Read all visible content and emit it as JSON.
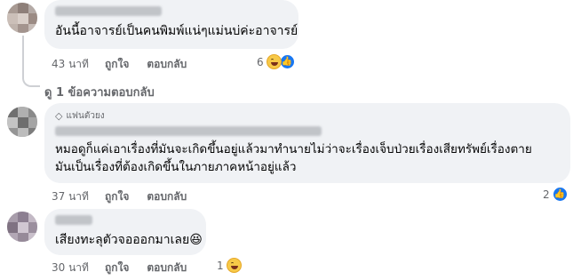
{
  "comments": [
    {
      "text_lines": [
        "อันนี้อาจารย์เป็นคนพิมพ์แน่ๆแม่นบ่ค่ะอาจารย์"
      ],
      "time": "43 นาที",
      "like_label": "ถูกใจ",
      "reply_label": "ตอบกลับ",
      "reaction_count": "6",
      "reactions": [
        "haha-icon",
        "like-icon"
      ]
    },
    {
      "badge": "แฟนตัวยง",
      "text_lines": [
        "หมอดูก็แค่เอาเรื่องที่มันจะเกิดขึ้นอยู่แล้วมาทำนายไม่ว่าจะเรื่องเจ็บป่วยเรื่องเสียทรัพย์เรื่องตาย",
        "มันเป็นเรื่องที่ต้องเกิดขึ้นในภายภาคหน้าอยู่แล้ว"
      ],
      "time": "37 นาที",
      "like_label": "ถูกใจ",
      "reply_label": "ตอบกลับ",
      "reaction_count": "2",
      "reactions": [
        "like-icon"
      ]
    },
    {
      "text_lines": [
        "เสียงทะลุตัวจอออกมาเลย😆"
      ],
      "time": "30 นาที",
      "like_label": "ถูกใจ",
      "reply_label": "ตอบกลับ",
      "reaction_count": "1",
      "reactions": [
        "haha-icon"
      ]
    }
  ],
  "view_replies": "ดู 1 ข้อความตอบกลับ"
}
